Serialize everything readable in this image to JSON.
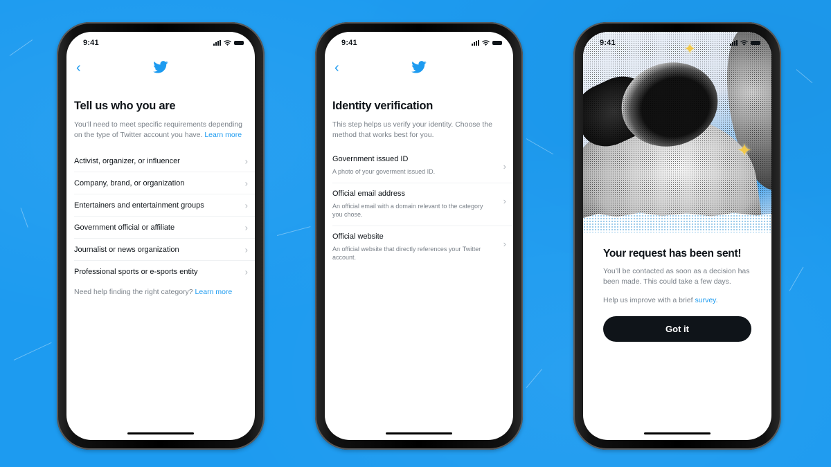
{
  "theme": {
    "background": "#1d9bf0",
    "accent": "#1d9bf0",
    "text": "#0f1419",
    "muted": "#7a8189",
    "button": "#0f1419"
  },
  "status_bar": {
    "time": "9:41",
    "icons": [
      "cellular-signal-icon",
      "wifi-icon",
      "battery-icon"
    ]
  },
  "nav": {
    "back_icon": "chevron-left",
    "logo_icon": "twitter-bird"
  },
  "screens": [
    {
      "title": "Tell us who you are",
      "description": "You’ll need to meet specific requirements depending on the type of Twitter account you have.",
      "description_link": "Learn more",
      "categories": [
        {
          "label": "Activist, organizer, or influencer"
        },
        {
          "label": "Company, brand, or organization"
        },
        {
          "label": "Entertainers and entertainment groups"
        },
        {
          "label": "Government official or affiliate"
        },
        {
          "label": "Journalist or news organization"
        },
        {
          "label": "Professional sports or e-sports entity"
        }
      ],
      "help_text": "Need help finding the right category?",
      "help_link": "Learn more"
    },
    {
      "title": "Identity verification",
      "description": "This step helps us verify your identity. Choose the method that works best for you.",
      "methods": [
        {
          "title": "Government issued ID",
          "subtitle": "A photo of your goverment issued ID."
        },
        {
          "title": "Official email address",
          "subtitle": "An official email with a domain relevant to the category you chose."
        },
        {
          "title": "Official website",
          "subtitle": "An official website that directly references your Twitter account."
        }
      ]
    },
    {
      "hero_image": "halftone-astronaut-illustration",
      "title": "Your request has been sent!",
      "description": "You’ll be contacted as soon as a decision has been made. This could take a few days.",
      "survey_text": "Help us improve with a brief",
      "survey_link": "survey",
      "survey_suffix": ".",
      "button_label": "Got it"
    }
  ]
}
